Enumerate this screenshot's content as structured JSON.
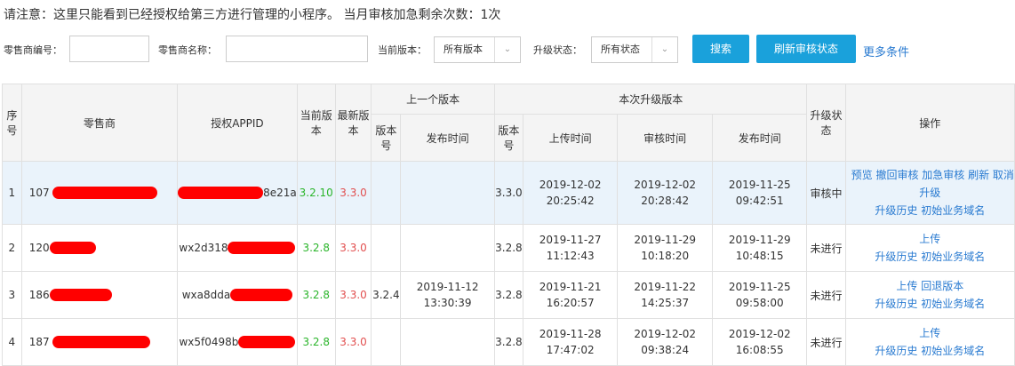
{
  "notice": "请注意：这里只能看到已经授权给第三方进行管理的小程序。 当月审核加急剩余次数：1次",
  "filters": {
    "retailer_code_label": "零售商编号：",
    "retailer_name_label": "零售商名称：",
    "current_version_label": "当前版本：",
    "current_version_value": "所有版本",
    "upgrade_status_label": "升级状态：",
    "upgrade_status_value": "所有状态",
    "search_label": "搜索",
    "refresh_label": "刷新审核状态",
    "more_label": "更多条件"
  },
  "table": {
    "headers": {
      "seq": "序号",
      "retailer": "零售商",
      "appid": "授权APPID",
      "current_version": "当前版本",
      "latest_version": "最新版本",
      "prev_group": "上一个版本",
      "prev_ver": "版本号",
      "prev_publish": "发布时间",
      "this_group": "本次升级版本",
      "this_ver": "版本号",
      "upload_time": "上传时间",
      "review_time": "审核时间",
      "publish_time": "发布时间",
      "status": "升级状态",
      "ops": "操作"
    },
    "rows": [
      {
        "seq": "1",
        "retailer_prefix": "107",
        "appid_prefix": "",
        "appid_suffix": "8e21a",
        "current": "3.2.10",
        "latest": "3.3.0",
        "prev_ver": "",
        "prev_publish_date": "",
        "prev_publish_time": "",
        "this_ver": "3.3.0",
        "upload_date": "2019-12-02",
        "upload_time": "20:25:42",
        "review_date": "2019-12-02",
        "review_time": "20:28:42",
        "publish_date": "2019-11-25",
        "publish_time": "09:42:51",
        "status": "审核中",
        "ops_line1": "预览 撤回审核 加急审核 刷新 取消",
        "ops_line2": "升级",
        "ops_line3": "升级历史 初始业务域名"
      },
      {
        "seq": "2",
        "retailer_prefix": "120",
        "appid_prefix": "wx2d318",
        "appid_suffix": "",
        "current": "3.2.8",
        "latest": "3.3.0",
        "prev_ver": "",
        "prev_publish_date": "",
        "prev_publish_time": "",
        "this_ver": "3.2.8",
        "upload_date": "2019-11-27",
        "upload_time": "11:12:43",
        "review_date": "2019-11-29",
        "review_time": "10:18:20",
        "publish_date": "2019-11-29",
        "publish_time": "10:48:15",
        "status": "未进行",
        "ops_line1": "上传",
        "ops_line2": "",
        "ops_line3": "升级历史 初始业务域名"
      },
      {
        "seq": "3",
        "retailer_prefix": "186",
        "appid_prefix": "wxa8dda",
        "appid_suffix": "",
        "current": "3.2.8",
        "latest": "3.3.0",
        "prev_ver": "3.2.4",
        "prev_publish_date": "2019-11-12",
        "prev_publish_time": "13:30:39",
        "this_ver": "3.2.8",
        "upload_date": "2019-11-21",
        "upload_time": "16:20:57",
        "review_date": "2019-11-22",
        "review_time": "14:25:37",
        "publish_date": "2019-11-25",
        "publish_time": "09:58:00",
        "status": "未进行",
        "ops_line1": "上传 回退版本",
        "ops_line2": "",
        "ops_line3": "升级历史 初始业务域名"
      },
      {
        "seq": "4",
        "retailer_prefix": "187",
        "appid_prefix": "wx5f0498b",
        "appid_suffix": "",
        "current": "3.2.8",
        "latest": "3.3.0",
        "prev_ver": "",
        "prev_publish_date": "",
        "prev_publish_time": "",
        "this_ver": "3.2.8",
        "upload_date": "2019-11-28",
        "upload_time": "17:47:02",
        "review_date": "2019-12-02",
        "review_time": "09:38:24",
        "publish_date": "2019-12-02",
        "publish_time": "16:08:55",
        "status": "未进行",
        "ops_line1": "上传",
        "ops_line2": "",
        "ops_line3": "升级历史 初始业务域名"
      }
    ]
  },
  "colors": {
    "accent": "#1aa1db",
    "link": "#2a7bd1",
    "current_version": "#2bb52b",
    "latest_version": "#e25050",
    "redaction": "#ff0000"
  }
}
